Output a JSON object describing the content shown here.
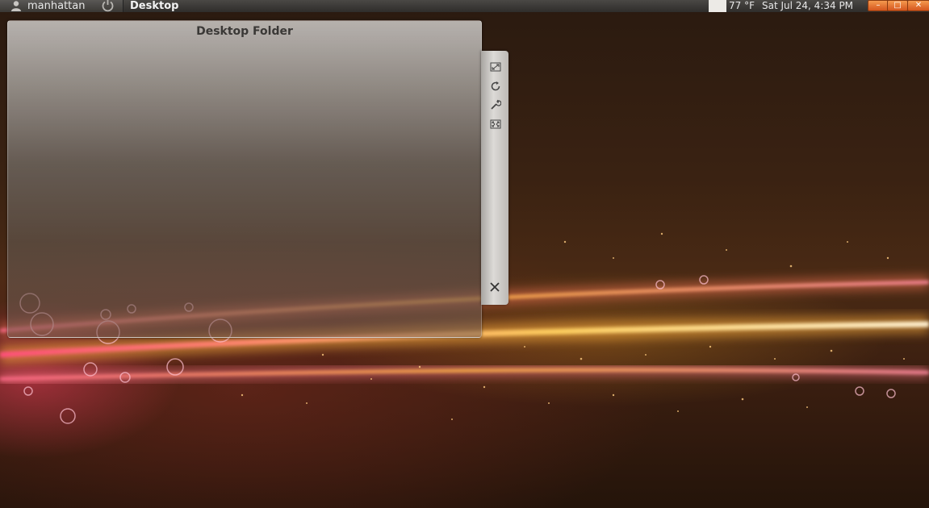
{
  "panel": {
    "user_name": "manhattan",
    "active_window_title": "Desktop",
    "weather": "77 °F",
    "clock": "Sat Jul 24,  4:34 PM",
    "window_buttons": {
      "minimize": "–",
      "maximize": "□",
      "close": "✕"
    }
  },
  "folder_view": {
    "title": "Desktop Folder"
  },
  "applet_handle": {
    "tools": [
      "resize-icon",
      "rotate-icon",
      "configure-icon",
      "expand-icon"
    ],
    "close": "✕"
  },
  "icons": {
    "user": "user-icon",
    "power": "power-icon"
  },
  "colors": {
    "panel_bg": "#2f2d2b",
    "window_button": "#e26a2c",
    "folder_title": "#3a3836"
  }
}
